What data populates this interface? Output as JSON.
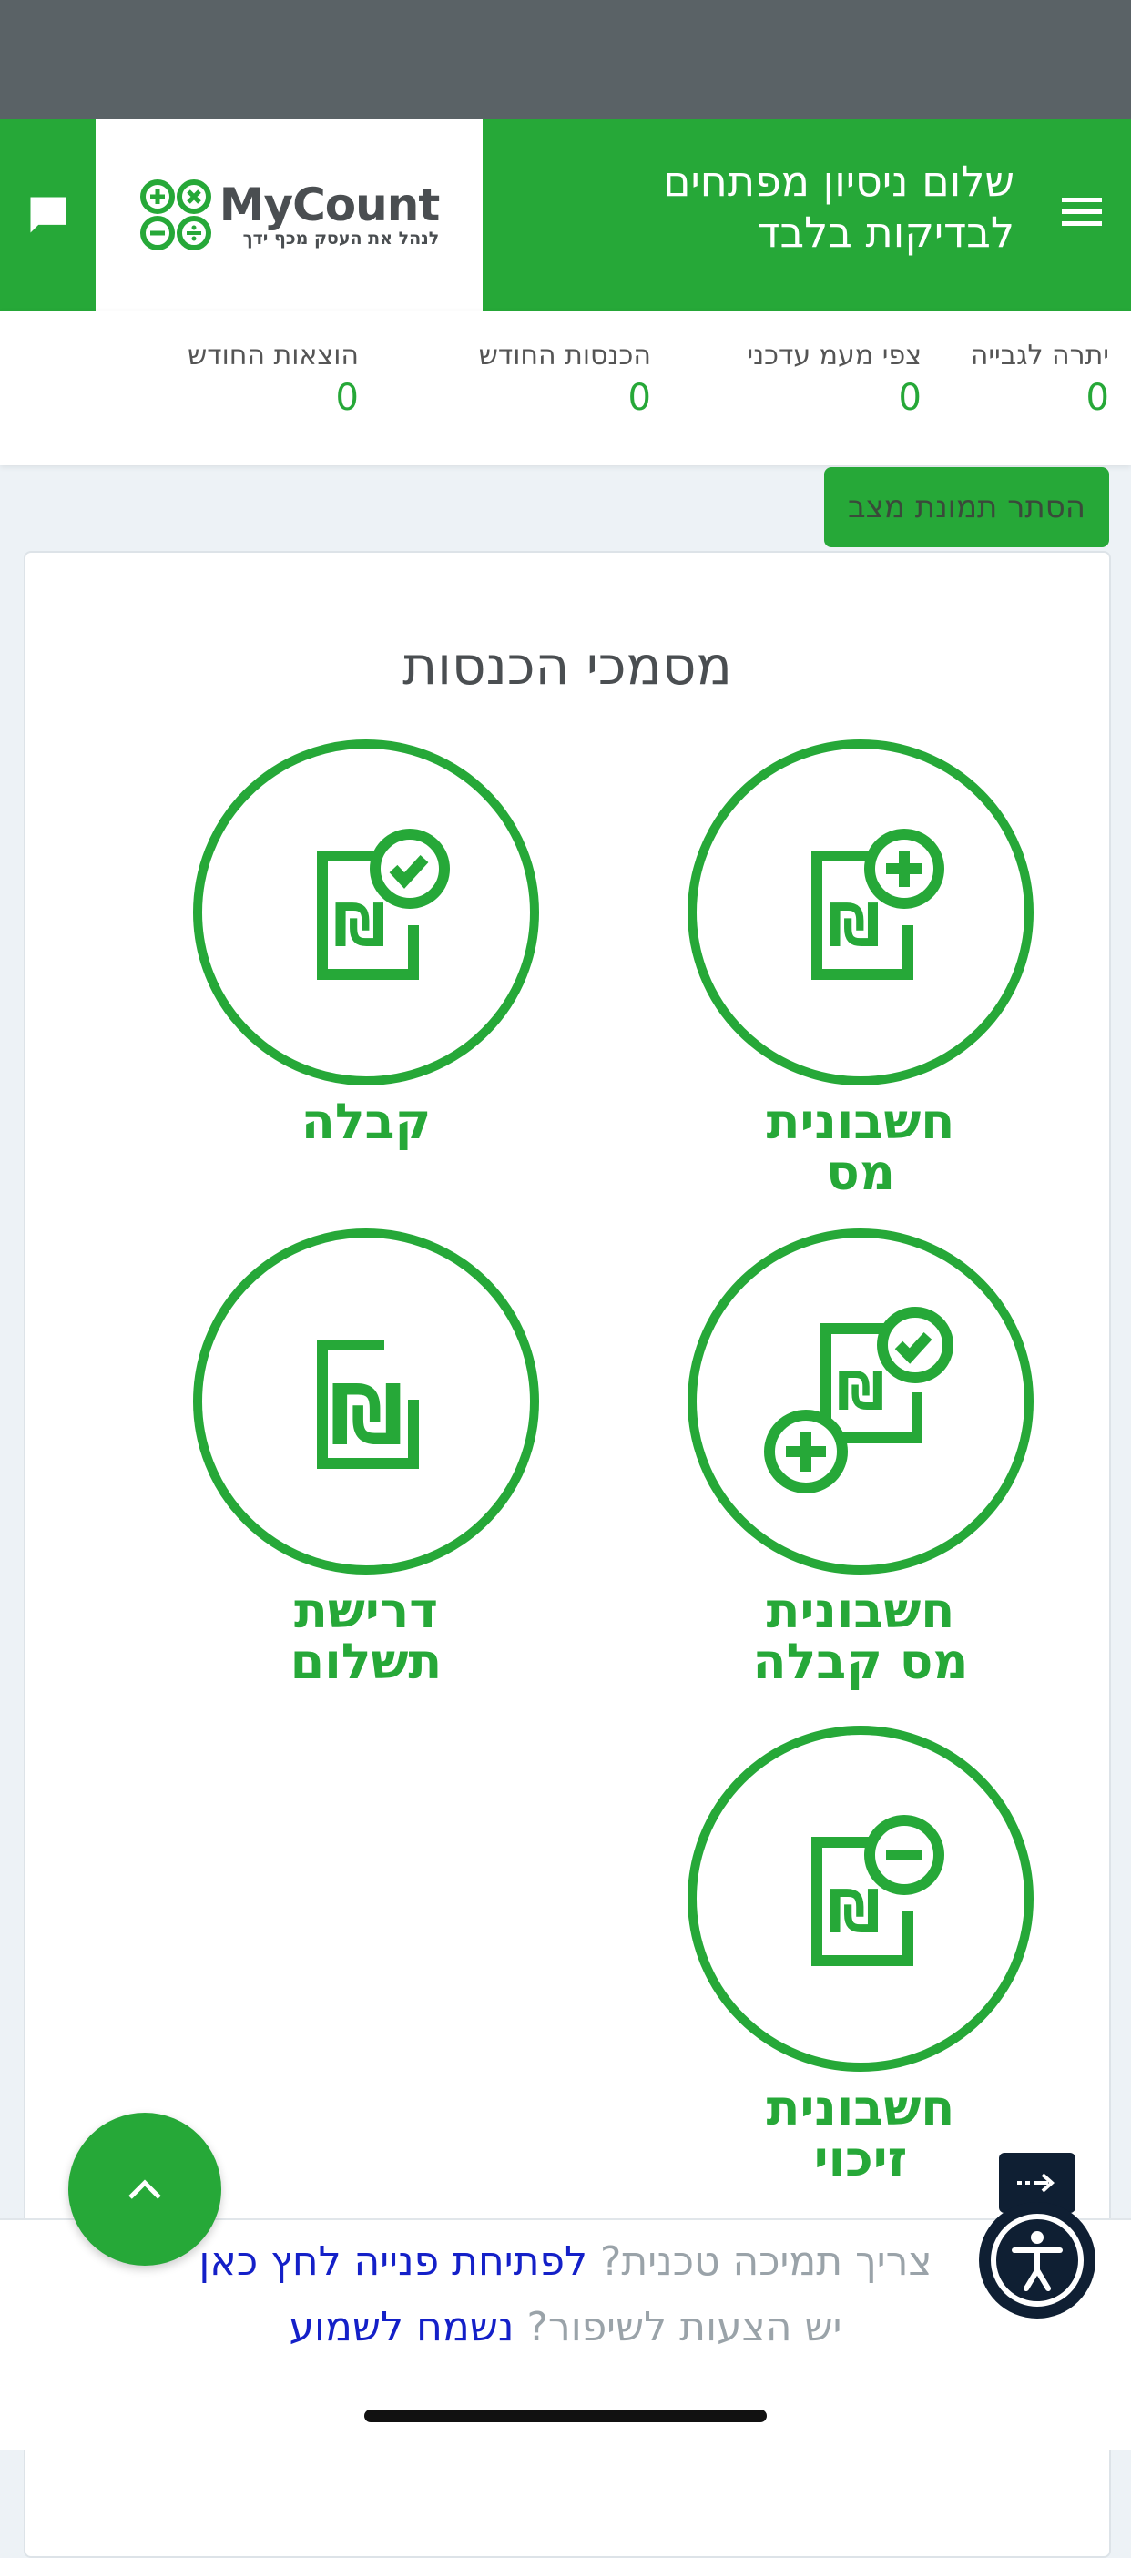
{
  "colors": {
    "brand_green": "#26a838",
    "header_gray": "#5a6266",
    "link_blue": "#1420c8",
    "dark_navy": "#0f1f33"
  },
  "header": {
    "greeting": "שלום ניסיון מפתחים לבדיקות בלבד",
    "logo": {
      "name": "MyCount",
      "tagline": "לנהל את העסק מכף ידך"
    },
    "menu_icon": "hamburger-menu-icon",
    "chat_icon": "chat-bubble-icon"
  },
  "stats": [
    {
      "label": "יתרה לגבייה",
      "value": "0"
    },
    {
      "label": "צפי מעמ עדכני",
      "value": "0"
    },
    {
      "label": "הכנסות החודש",
      "value": "0"
    },
    {
      "label": "הוצאות החודש",
      "value": "0"
    }
  ],
  "hide_button_label": "הסתר תמונת מצב",
  "section_title": "מסמכי הכנסות",
  "documents": [
    {
      "line1": "חשבונית",
      "line2": "מס",
      "icon": "invoice-plus-icon"
    },
    {
      "line1": "קבלה",
      "line2": "",
      "icon": "receipt-check-icon"
    },
    {
      "line1": "חשבונית",
      "line2": "מס קבלה",
      "icon": "invoice-receipt-icon"
    },
    {
      "line1": "דרישת",
      "line2": "תשלום",
      "icon": "payment-request-icon"
    },
    {
      "line1": "חשבונית",
      "line2": "זיכוי",
      "icon": "credit-note-minus-icon"
    }
  ],
  "support": {
    "line1_text": "צריך תמיכה טכנית?",
    "line1_link": "לפתיחת פנייה לחץ כאן",
    "line2_text": "יש הצעות לשיפור?",
    "line2_link": "נשמח לשמוע"
  }
}
